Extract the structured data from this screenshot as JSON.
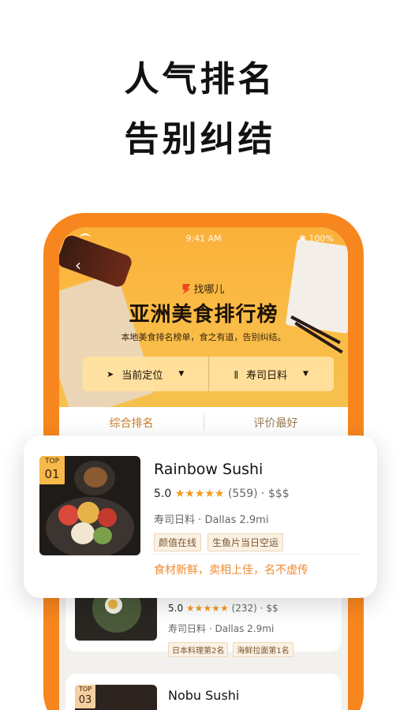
{
  "headline": {
    "line1": "人气排名",
    "line2": "告别纠结"
  },
  "status_bar": {
    "time": "9:41 AM",
    "battery": "100%"
  },
  "header": {
    "brand": "找哪儿",
    "title": "亚洲美食排行榜",
    "subtitle": "本地美食排名榜单，食之有道，告别纠结。"
  },
  "filters": {
    "location": {
      "label": "当前定位",
      "icon": "navigation-arrow-icon"
    },
    "cuisine": {
      "label": "寿司日料",
      "icon": "fork-knife-icon"
    }
  },
  "tabs": [
    {
      "label": "综合排名",
      "active": true
    },
    {
      "label": "评价最好",
      "active": false
    }
  ],
  "featured": {
    "rank_label": "TOP",
    "rank": "01",
    "name": "Rainbow Sushi",
    "rating": "5.0",
    "stars": "★★★★★",
    "reviews": "(559)",
    "price": "$$$",
    "category": "寿司日料",
    "location": "Dallas 2.9mi",
    "tags": [
      "颜值在线",
      "生鱼片当日空运"
    ],
    "quote": "食材新鲜，卖相上佳，名不虚传"
  },
  "list": [
    {
      "rating": "5.0",
      "stars": "★★★★★",
      "reviews": "(232)",
      "price": "$$",
      "category": "寿司日料",
      "location": "Dallas 2.9mi",
      "tags": [
        "日本料理第2名",
        "海鲜拉面第1名"
      ]
    },
    {
      "rank_label": "TOP",
      "rank": "03",
      "name": "Nobu Sushi"
    }
  ],
  "colors": {
    "accent": "#f7861e",
    "star": "#f39a1e",
    "quote": "#ef8a2c"
  }
}
